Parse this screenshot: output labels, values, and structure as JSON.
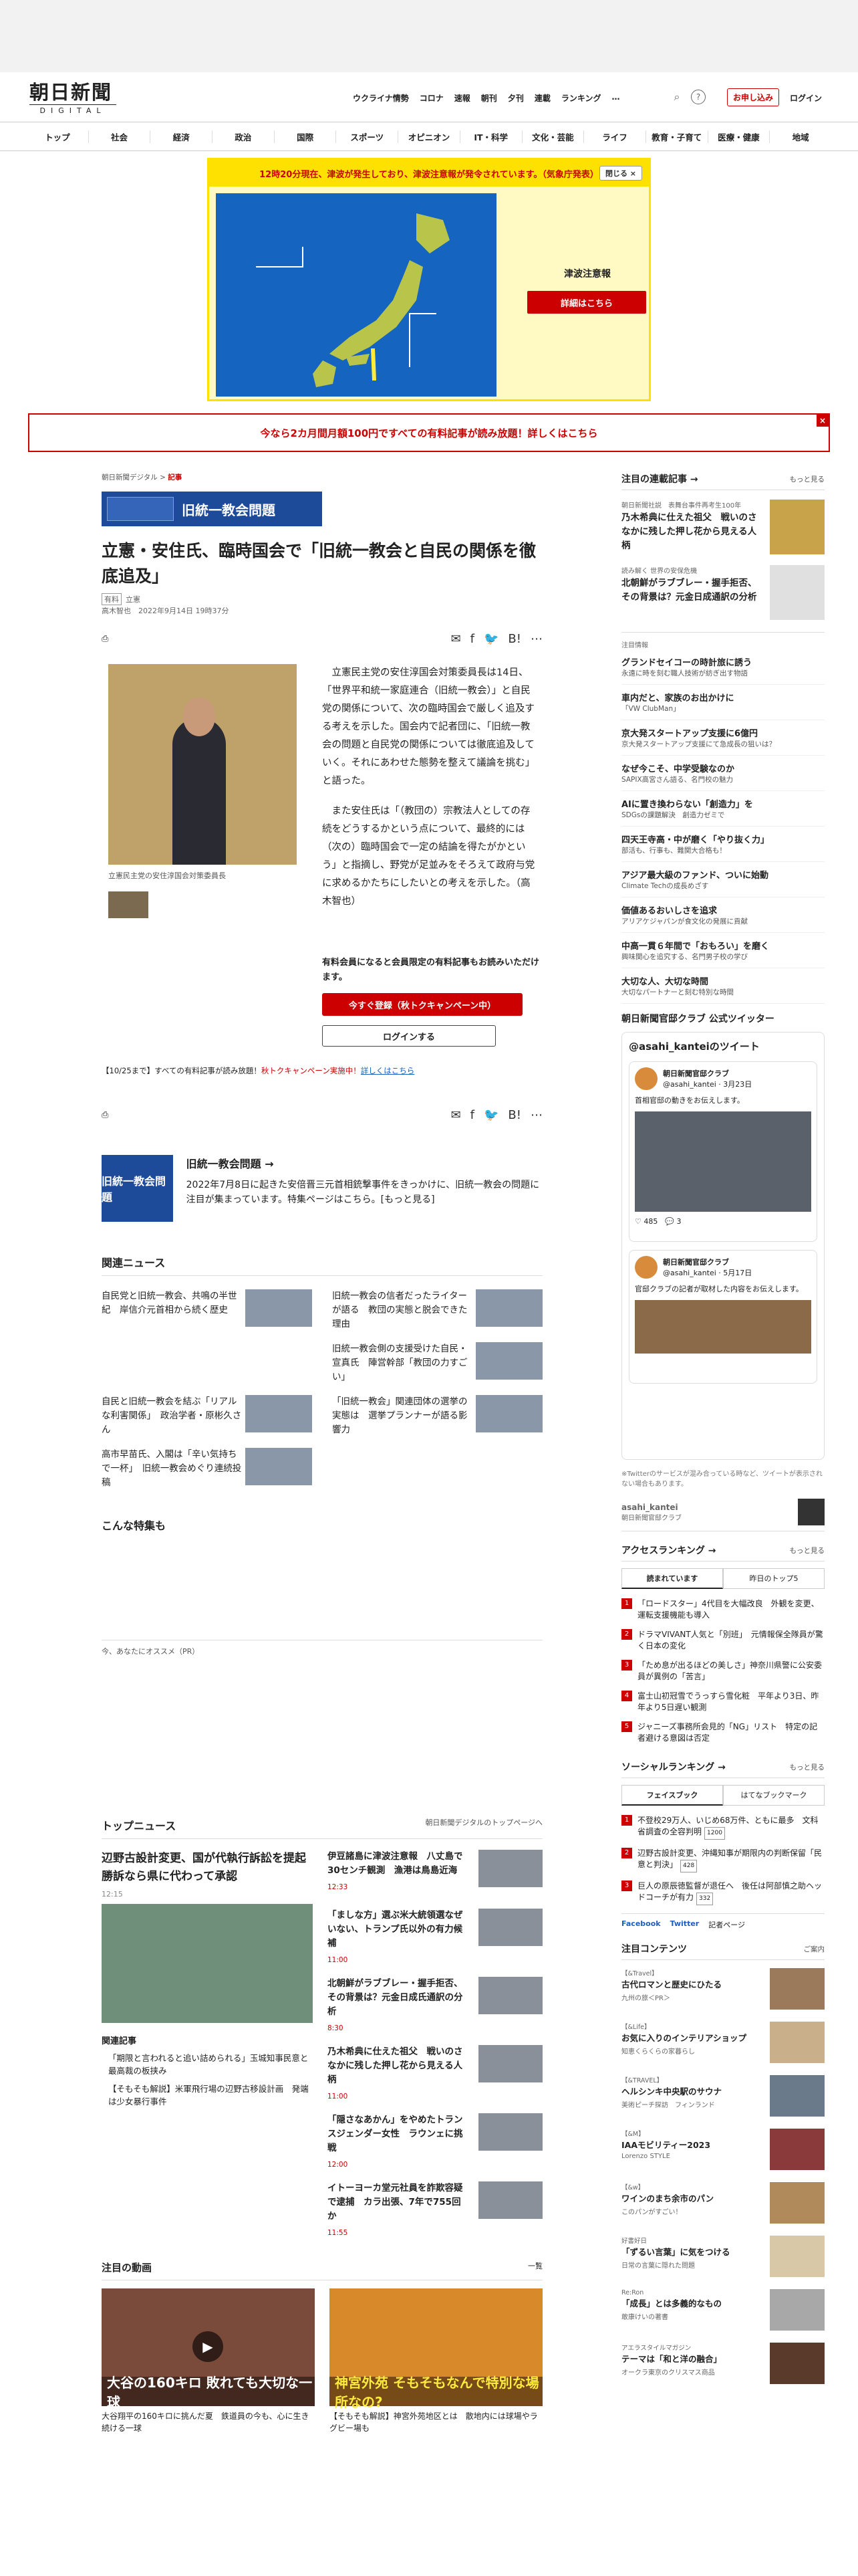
{
  "header": {
    "logo_main": "朝日新聞",
    "logo_sub": "DIGITAL",
    "links": [
      "ウクライナ情勢",
      "コロナ",
      "速報",
      "朝刊",
      "夕刊",
      "連載",
      "ランキング",
      "…"
    ],
    "subscribe": "お申し込み",
    "login": "ログイン"
  },
  "nav": [
    "トップ",
    "社会",
    "経済",
    "政治",
    "国際",
    "スポーツ",
    "オピニオン",
    "IT・科学",
    "文化・芸能",
    "ライフ",
    "教育・子育て",
    "医療・健康",
    "地域"
  ],
  "alert": {
    "headline": "12時20分現在、津波が発生しており、津波注意報が発令されています。（気象庁発表）",
    "close": "閉じる ×",
    "label": "津波注意報",
    "button": "詳細はこちら"
  },
  "promo": {
    "text": "今なら2カ月間月額100円ですべての有料記事が読み放題！詳しくはこちら",
    "close": "×"
  },
  "article": {
    "crumb_site": "朝日新聞デジタル",
    "crumb_sep": ">",
    "crumb_cat": "記事",
    "tag_banner": "旧統一教会問題",
    "title": "立憲・安住氏、臨時国会で「旧統一教会と自民の関係を徹底追及」",
    "tag": "有料",
    "tag2": "立憲",
    "author_date": "高木智也　2022年9月14日 19時37分",
    "photo_caption": "立憲民主党の安住淳国会対策委員長",
    "p1": "立憲民主党の安住淳国会対策委員長は14日、「世界平和統一家庭連合（旧統一教会）」と自民党の関係について、次の臨時国会で厳しく追及する考えを示した。国会内で記者団に、「旧統一教会の問題と自民党の関係については徹底追及していく。それにあわせた態勢を整えて議論を挑む」と語った。",
    "p2": "また安住氏は「（教団の）宗教法人としての存続をどうするかという点について、最終的には（次の）臨時国会で一定の結論を得たがかという」と指摘し、野党が足並みをそろえて政府与党に求めるかたちにしたいとの考えを示した。（高木智也）",
    "paywall_text": "有料会員になると会員限定の有料記事もお読みいただけます。",
    "register_button": "今すぐ登録（秋トクキャンペーン中）",
    "login_button": "ログインする",
    "campaign_prefix": "【10/25まで】すべての有料記事が読み放題！",
    "campaign_red": "秋トクキャンペーン実施中！",
    "campaign_suffix": "詳しくはこちら"
  },
  "special": {
    "image_label": "旧統一教会問題",
    "title": "旧統一教会問題 →",
    "desc": "2022年7月8日に起きた安倍晋三元首相銃撃事件をきっかけに、旧統一教会の問題に注目が集まっています。特集ページはこちら。[もっと見る]"
  },
  "related": {
    "heading": "関連ニュース",
    "items": [
      "自民党と旧統一教会、共鳴の半世紀　岸信介元首相から続く歴史",
      "旧統一教会の信者だったライターが語る　教団の実態と脱会できた理由",
      "",
      "旧統一教会側の支援受けた自民・宣真氏　陣営幹部「教団の力すごい」",
      "自民と旧統一教会を結ぶ「リアルな利害関係」　政治学者・原彬久さん",
      "「旧統一教会」関連団体の選挙の実態は　選挙プランナーが語る影響力",
      "高市早苗氏、入閣は「辛い気持ちで一杯」　旧統一教会めぐり連続投稿"
    ]
  },
  "feature_heading": "こんな特集も",
  "recommend": "今、あなたにオススメ（PR）",
  "topnews": {
    "heading": "トップニュース",
    "link": "朝日新聞デジタルのトップページへ",
    "main_title": "辺野古設計変更、国が代執行訴訟を提起　勝訴なら県に代わって承認",
    "main_time": "12:15",
    "related_heading": "関連記事",
    "related": [
      "「期限と言われると追い詰められる」玉城知事民意と最高裁の板挟み",
      "【そもそも解説】米軍飛行場の辺野古移設計画　発端は少女暴行事件"
    ],
    "items": [
      {
        "title": "伊豆諸島に津波注意報　八丈島で30センチ観測　漁港は鳥島近海",
        "time": "12:33"
      },
      {
        "title": "「ましな方」選ぶ米大統領選なぜいない、トランプ氏以外の有力候補",
        "time": "11:00"
      },
      {
        "title": "北朝鮮がラブブレー・握手拒否、その背景は？元金日成氏通訳の分析",
        "time": "8:30"
      },
      {
        "title": "乃木希典に仕えた祖父　戦いのさなかに残した押し花から見える人柄",
        "time": "11:00"
      },
      {
        "title": "「隠さなあかん」をやめたトランスジェンダー女性　ラウンェに挑戦",
        "time": "12:00"
      },
      {
        "title": "イトーヨーカ堂元社員を詐欺容疑で逮捕　カラ出張、7年で755回か",
        "time": "11:55"
      }
    ]
  },
  "videos": {
    "heading": "注目の動画",
    "link": "一覧",
    "items": [
      {
        "overlay": "大谷の160キロ 敗れても大切な一球",
        "text": "大谷翔平の160キロに挑んだ夏　鉄道員の今も、心に生き続ける一球"
      },
      {
        "overlay": "神宮外苑 そもそもなんで特別な場所なの?",
        "text": "【そもそも解説】神宮外苑地区とは　散地内には球場やラグビー場も"
      }
    ]
  },
  "side": {
    "picks_heading": "注目の連載記事 →",
    "picks_link": "もっと見る",
    "picks": [
      {
        "label": "朝日新聞社説　表舞台事件再考生100年",
        "title": "乃木希典に仕えた祖父　戦いのさなかに残した押し花から見える人柄"
      },
      {
        "label": "読み解く 世界の安保危機",
        "title": "北朝鮮がラブブレー・握手拒否、その背景は？元金日成通訳の分析"
      }
    ],
    "pr_label": "注目情報",
    "pr": [
      {
        "title": "グランドセイコーの時計旅に誘う",
        "sub": "永遠に時を刻む職人技術が紡ぎ出す物語"
      },
      {
        "title": "車内だと、家族のお出かけに",
        "sub": "「VW ClubMan」"
      },
      {
        "title": "京大発スタートアップ支援に6億円",
        "sub": "京大発スタートアップ支援にて急成長の狙いは？"
      },
      {
        "title": "なぜ今こそ、中学受験なのか",
        "sub": "SAPIX高宮さん語る、名門校の魅力"
      },
      {
        "title": "AIに置き換わらない「創造力」を",
        "sub": "SDGsの課題解決　創造力ゼミで"
      },
      {
        "title": "四天王寺高・中が磨く「やり抜く力」",
        "sub": "部活も、行事も、難関大合格も！"
      },
      {
        "title": "アジア最大級のファンド、ついに始動",
        "sub": "Climate Techの成長めざす"
      },
      {
        "title": "価値あるおいしさを追求",
        "sub": "アリアケジャパンが食文化の発展に貢献"
      },
      {
        "title": "中高一貫６年間で「おもろい」を磨く",
        "sub": "興味関心を追究する、名門男子校の学び"
      },
      {
        "title": "大切な人、大切な時間",
        "sub": "大切なパートナーと刻む特別な時間"
      }
    ],
    "twitter_heading": "朝日新聞官邸クラブ 公式ツイッター",
    "twitter_box_title": "@asahi_kanteiのツイート",
    "tweets": [
      {
        "user": "朝日新聞官邸クラブ",
        "handle": "@asahi_kantei · 3月23日",
        "text": "首相官邸の動きをお伝えします。"
      },
      {
        "user": "朝日新聞官邸クラブ",
        "handle": "@asahi_kantei · 5月17日",
        "text": "官邸クラブの記者が取材した内容をお伝えします。"
      }
    ],
    "tweet_stats": "♡ 485　💬 3",
    "twitter_note": "※Twitterのサービスが混み合っている時など、ツイートが表示されない場合もあります。",
    "twitter_acct": "asahi_kantei",
    "twitter_acct_sub": "朝日新聞官邸クラブ",
    "ranking_heading": "アクセスランキング →",
    "ranking_link": "もっと見る",
    "ranking_tabs": [
      "読まれています",
      "昨日のトップ5"
    ],
    "ranking": [
      "「ロードスター」4代目を大幅改良　外観を変更、運転支援機能も導入",
      "ドラマVIVANT人気と「別班」　元情報保全隊員が驚く日本の変化",
      "「ため息が出るほどの美しさ」神奈川県警に公安委員が異例の「苦言」",
      "富士山初冠雪でうっすら雪化粧　平年より3日、昨年より5日遅い観測",
      "ジャニーズ事務所会見的「NG」リスト　特定の記者避ける意図は否定"
    ],
    "social_heading": "ソーシャルランキング →",
    "social_link": "もっと見る",
    "social_tabs": [
      "フェイスブック",
      "はてなブックマーク"
    ],
    "social": [
      {
        "text": "不登校29万人、いじめ68万件、ともに最多　文科省調査の全容判明",
        "count": "1200"
      },
      {
        "text": "辺野古設計変更、沖縄知事が期限内の判断保留「民意と判決」",
        "count": "428"
      },
      {
        "text": "巨人の原辰徳監督が退任へ　後任は阿部慎之助ヘッドコーチが有力",
        "count": "332"
      }
    ],
    "sns": [
      "Facebook",
      "Twitter",
      "記者ページ"
    ],
    "contents_heading": "注目コンテンツ",
    "contents_link": "ご案内",
    "contents": [
      {
        "label": "【&Travel】",
        "title": "古代ロマンと歴史にひたる",
        "sub": "九州の旅＜PR＞"
      },
      {
        "label": "【&Life】",
        "title": "お気に入りのインテリアショップ",
        "sub": "知恵くらくらの家暮らし"
      },
      {
        "label": "【&TRAVEL】",
        "title": "ヘルシンキ中央駅のサウナ",
        "sub": "美術ピーチ探訪　フィンランド"
      },
      {
        "label": "【&M】",
        "title": "IAAモビリティー2023",
        "sub": "Lorenzo STYLE"
      },
      {
        "label": "【&w】",
        "title": "ワインのまち余市のパン",
        "sub": "このパンがすごい！"
      },
      {
        "label": "好書好日",
        "title": "「ずるい言葉」に気をつける",
        "sub": "日常の言葉に隠れた問題"
      },
      {
        "label": "Re:Ron",
        "title": "「成長」とは多義的なもの",
        "sub": "敢康けいの著書"
      },
      {
        "label": "アエラスタイルマガジン",
        "title": "テーマは「和と洋の融合」",
        "sub": "オークラ東京のクリスマス商品"
      }
    ]
  }
}
